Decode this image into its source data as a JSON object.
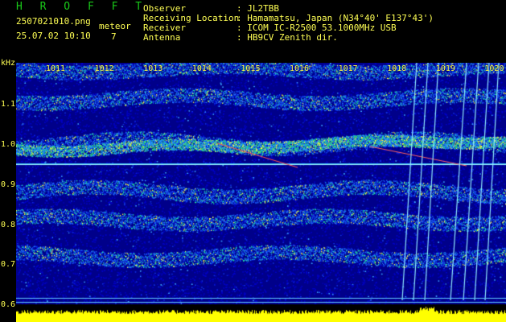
{
  "header": {
    "brand": "H R O F F T",
    "filename": "2507021010.png",
    "datetime": "25.07.02 10:10",
    "meteor_label": "meteor",
    "meteor_count": "7",
    "fields": [
      {
        "label": "Observer",
        "value": ": JL2TBB"
      },
      {
        "label": "Receiving Location",
        "value": ": Hamamatsu, Japan (N34°40' E137°43')"
      },
      {
        "label": "Receiver",
        "value": ": ICOM IC-R2500 53.1000MHz USB"
      },
      {
        "label": "Antenna",
        "value": ": HB9CV Zenith dir."
      }
    ]
  },
  "y_axis": {
    "unit": "kHz",
    "ticks": [
      "1.1",
      "1.0",
      "0.9",
      "0.8",
      "0.7",
      "0.6"
    ],
    "tick_values": [
      1.1,
      1.0,
      0.9,
      0.8,
      0.7,
      0.6
    ],
    "range": [
      0.575,
      1.16
    ]
  },
  "x_axis": {
    "ticks": [
      "1011",
      "1012",
      "1013",
      "1014",
      "1015",
      "1016",
      "1017",
      "1018",
      "1019",
      "1020"
    ]
  },
  "colors": {
    "background": "#000000",
    "brand": "#19c919",
    "text": "#ffff54",
    "spectrum_low": "#0000c0",
    "spectrum_high": "#ffff00",
    "carrier": "#40d0ff"
  }
}
